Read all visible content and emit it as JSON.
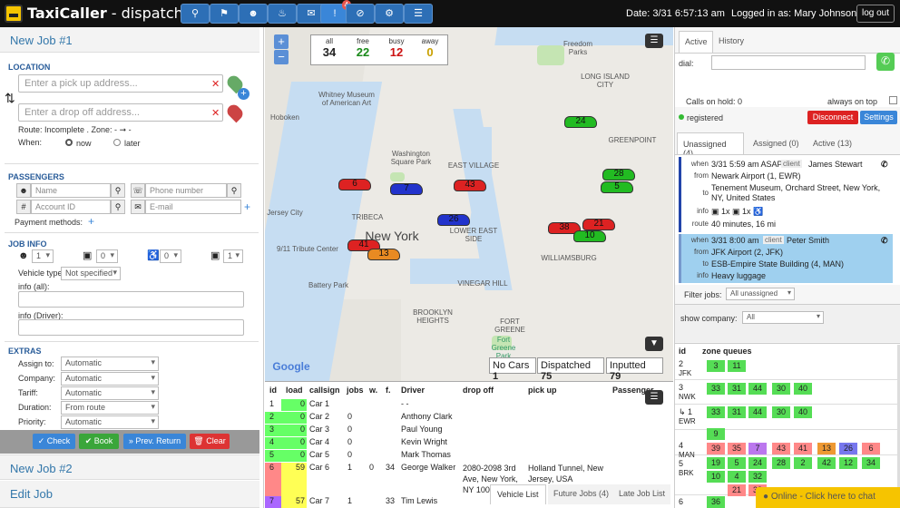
{
  "app": {
    "title_bold": "TaxiCaller",
    "title_rest": " - dispatch",
    "date": "Date: 3/31 6:57:13 am",
    "logged_in": "Logged in as: Mary Johnson",
    "logout": "log out",
    "notif_count": "4"
  },
  "nav_icons": [
    "search-icon",
    "flag-icon",
    "group-icon",
    "bell-icon",
    "chat-icon",
    "alert-icon",
    "block-icon",
    "gear-icon",
    "list-icon"
  ],
  "left": {
    "job1": "New Job #1",
    "location": "LOCATION",
    "pickup_ph": "Enter a pick up address...",
    "dropoff_ph": "Enter a drop off address...",
    "route": "Route: Incomplete . Zone: -",
    "when_label": "When:",
    "now": "now",
    "later": "later",
    "passengers": "PASSENGERS",
    "name_ph": "Name",
    "phone_ph": "Phone number",
    "account_ph": "Account ID",
    "email_ph": "E-mail",
    "payment": "Payment methods:",
    "jobinfo": "JOB INFO",
    "counts": [
      "1",
      "0",
      "0",
      "1"
    ],
    "vehicle_type_label": "Vehicle type:",
    "vehicle_type": "Not specified",
    "info_all": "info (all):",
    "info_driver": "info (Driver):",
    "extras": "EXTRAS",
    "assign_label": "Assign to:",
    "assign": "Automatic",
    "company_label": "Company:",
    "company": "Automatic",
    "tariff_label": "Tariff:",
    "tariff": "Automatic",
    "duration_label": "Duration:",
    "duration": "From route",
    "priority_label": "Priority:",
    "priority": "Automatic",
    "btn_check": "Check",
    "btn_book": "Book",
    "btn_prev": "Prev. Return",
    "btn_clear": "Clear",
    "job2": "New Job #2",
    "edit": "Edit Job"
  },
  "map": {
    "stats": [
      {
        "t": "all",
        "v": "34",
        "c": "#111"
      },
      {
        "t": "free",
        "v": "22",
        "c": "#1a8a1a"
      },
      {
        "t": "busy",
        "v": "12",
        "c": "#cc1111"
      },
      {
        "t": "away",
        "v": "0",
        "c": "#c9a000"
      }
    ],
    "labels": [
      "Whitney Museum of American Art",
      "Washington Square Park",
      "EAST VILLAGE",
      "TRIBECA",
      "New York",
      "9/11 Tribute Center",
      "Battery Park",
      "LOWER EAST SIDE",
      "WILLIAMSBURG",
      "VINEGAR HILL",
      "BROOKLYN HEIGHTS",
      "FORT GREENE",
      "Fort Greene Park",
      "Freedom Parks",
      "LONG ISLAND CITY",
      "GREENPOINT",
      "Hoboken",
      "Jersey City",
      "Google"
    ],
    "cars": [
      {
        "n": "24",
        "c": "#22bb22"
      },
      {
        "n": "6",
        "c": "#dd2222"
      },
      {
        "n": "7",
        "c": "#2233cc"
      },
      {
        "n": "43",
        "c": "#dd2222"
      },
      {
        "n": "28",
        "c": "#22bb22"
      },
      {
        "n": "5",
        "c": "#22bb22"
      },
      {
        "n": "26",
        "c": "#2233cc"
      },
      {
        "n": "21",
        "c": "#dd2222"
      },
      {
        "n": "38",
        "c": "#dd2222"
      },
      {
        "n": "10",
        "c": "#22bb22"
      },
      {
        "n": "41",
        "c": "#dd2222"
      },
      {
        "n": "13",
        "c": "#e88a22"
      }
    ],
    "summary": [
      {
        "t": "No Cars ",
        "v": "1"
      },
      {
        "t": "Dispatched ",
        "v": "75"
      },
      {
        "t": "Inputted ",
        "v": "79"
      }
    ]
  },
  "vehicles": {
    "headers": [
      "id",
      "load",
      "callsign",
      "jobs",
      "w.",
      "f.",
      "Driver",
      "drop off",
      "pick up",
      "Passenger"
    ],
    "rows": [
      {
        "id": "1",
        "load": "0",
        "cs": "Car 1",
        "jobs": "",
        "w": "",
        "f": "",
        "driver": "- -",
        "drop": "",
        "pick": "",
        "color": "#6f6"
      },
      {
        "id": "2",
        "load": "0",
        "cs": "Car 2",
        "jobs": "0",
        "w": "",
        "f": "",
        "driver": "Anthony Clark",
        "drop": "",
        "pick": "",
        "color": "#6f6"
      },
      {
        "id": "3",
        "load": "0",
        "cs": "Car 3",
        "jobs": "0",
        "w": "",
        "f": "",
        "driver": "Paul Young",
        "drop": "",
        "pick": "",
        "color": "#6f6"
      },
      {
        "id": "4",
        "load": "0",
        "cs": "Car 4",
        "jobs": "0",
        "w": "",
        "f": "",
        "driver": "Kevin Wright",
        "drop": "",
        "pick": "",
        "color": "#6f6"
      },
      {
        "id": "5",
        "load": "0",
        "cs": "Car 5",
        "jobs": "0",
        "w": "",
        "f": "",
        "driver": "Mark Thomas",
        "drop": "",
        "pick": "",
        "color": "#6f6"
      },
      {
        "id": "6",
        "load": "59",
        "cs": "Car 6",
        "jobs": "1",
        "w": "0",
        "f": "34",
        "driver": "George Walker",
        "drop": "2080-2098 3rd Ave, New York, NY 100",
        "pick": "Holland Tunnel, New Jersey, USA",
        "color": "#f88"
      },
      {
        "id": "7",
        "load": "57",
        "cs": "Car 7",
        "jobs": "1",
        "w": "",
        "f": "33",
        "driver": "Tim Lewis",
        "drop": "",
        "pick": "",
        "color": "#a6f"
      }
    ],
    "tabs": [
      "Vehicle List",
      "Future Jobs (4)",
      "Late Job List"
    ]
  },
  "right": {
    "tab_active": "Active",
    "tab_history": "History",
    "dial": "dial:",
    "calls_hold": "Calls on hold: 0",
    "always_top": "always on top",
    "registered": "registered",
    "disconnect": "Disconnect",
    "settings": "Settings",
    "jobtabs": [
      "Unassigned (4)",
      "Assigned (0)",
      "Active (13)"
    ],
    "job1": {
      "when": "3/31 5:59 am ASAP",
      "client": "James Stewart",
      "from": "Newark Airport (1, EWR)",
      "to": "Tenement Museum, Orchard Street, New York, NY, United States",
      "info": "1x  1x  1x",
      "route": "40 minutes, 16 mi"
    },
    "job2": {
      "when": "3/31 8:00 am",
      "client": "Peter Smith",
      "from": "JFK Airport (2, JFK)",
      "to": "ESB-Empire State Building (4, MAN)",
      "info": "Heavy luggage"
    },
    "filter_label": "Filter jobs:",
    "filter": "All unassigned",
    "company_label": "show company:",
    "company": "All",
    "zone_header_id": "id",
    "zone_header": "zone queues",
    "zones": [
      {
        "id": "2",
        "name": "JFK",
        "cells": [
          {
            "v": "3",
            "c": "#5d5"
          },
          {
            "v": "11",
            "c": "#5d5"
          }
        ]
      },
      {
        "id": "3",
        "name": "NWK",
        "cells": [
          {
            "v": "33",
            "c": "#5d5"
          },
          {
            "v": "31",
            "c": "#5d5"
          },
          {
            "v": "44",
            "c": "#5d5"
          },
          {
            "v": "30",
            "c": "#5d5"
          },
          {
            "v": "40",
            "c": "#5d5"
          }
        ]
      },
      {
        "id": "↳ 1",
        "name": "EWR",
        "cells": [
          {
            "v": "33",
            "c": "#5d5"
          },
          {
            "v": "31",
            "c": "#5d5"
          },
          {
            "v": "44",
            "c": "#5d5"
          },
          {
            "v": "30",
            "c": "#5d5"
          },
          {
            "v": "40",
            "c": "#5d5"
          }
        ]
      },
      {
        "id": "4",
        "name": "MAN",
        "cells": [
          {
            "v": "9",
            "c": "#5d5"
          },
          {
            "v": "39",
            "c": "#f88"
          },
          {
            "v": "35",
            "c": "#f88"
          },
          {
            "v": "7",
            "c": "#b7e"
          },
          {
            "v": "43",
            "c": "#f88"
          },
          {
            "v": "41",
            "c": "#f88"
          },
          {
            "v": "13",
            "c": "#e93"
          },
          {
            "v": "26",
            "c": "#77e"
          },
          {
            "v": "6",
            "c": "#f88"
          }
        ]
      },
      {
        "id": "5",
        "name": "BRK",
        "cells": [
          {
            "v": "19",
            "c": "#5d5"
          },
          {
            "v": "5",
            "c": "#5d5"
          },
          {
            "v": "24",
            "c": "#5d5"
          },
          {
            "v": "28",
            "c": "#5d5"
          },
          {
            "v": "2",
            "c": "#5d5"
          },
          {
            "v": "42",
            "c": "#5d5"
          },
          {
            "v": "12",
            "c": "#5d5"
          },
          {
            "v": "34",
            "c": "#5d5"
          },
          {
            "v": "10",
            "c": "#5d5"
          },
          {
            "v": "4",
            "c": "#5d5"
          },
          {
            "v": "32",
            "c": "#5d5"
          },
          {
            "v": "21",
            "c": "#f88"
          },
          {
            "v": "38",
            "c": "#f88"
          }
        ]
      },
      {
        "id": "6",
        "name": "",
        "cells": [
          {
            "v": "36",
            "c": "#5d5"
          }
        ]
      }
    ],
    "chat": "Online - Click here to chat"
  }
}
